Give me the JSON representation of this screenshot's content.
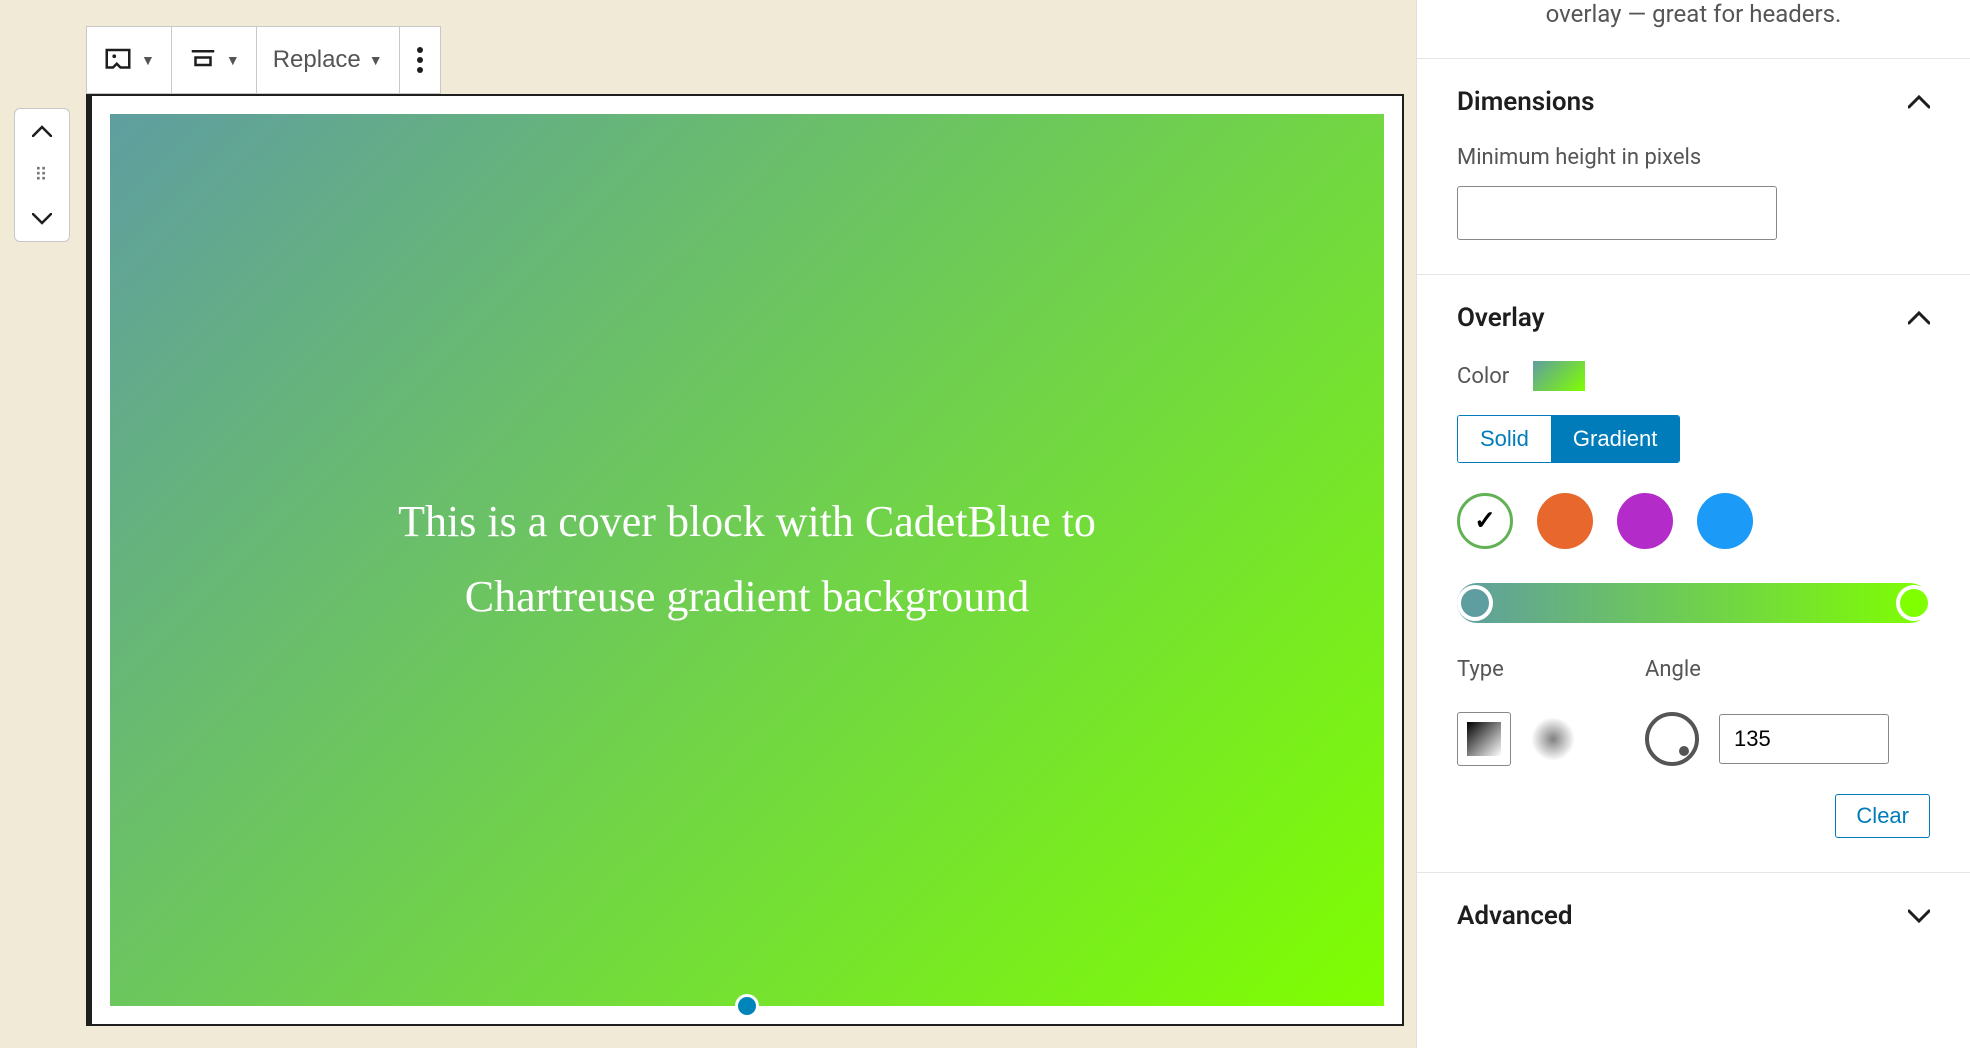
{
  "description_tail": "overlay — great for headers.",
  "toolbar": {
    "replace_label": "Replace"
  },
  "cover": {
    "text": "This is a cover block with CadetBlue to Chartreuse gradient background"
  },
  "panels": {
    "dimensions": {
      "title": "Dimensions",
      "min_height_label": "Minimum height in pixels",
      "min_height_value": ""
    },
    "overlay": {
      "title": "Overlay",
      "color_label": "Color",
      "solid_label": "Solid",
      "gradient_label": "Gradient",
      "type_label": "Type",
      "angle_label": "Angle",
      "angle_value": "135",
      "clear_label": "Clear",
      "gradient_start": "#5f9ea0",
      "gradient_end": "#7fff00",
      "presets": [
        "green-check",
        "orange",
        "purple",
        "blue"
      ]
    },
    "advanced": {
      "title": "Advanced"
    }
  }
}
